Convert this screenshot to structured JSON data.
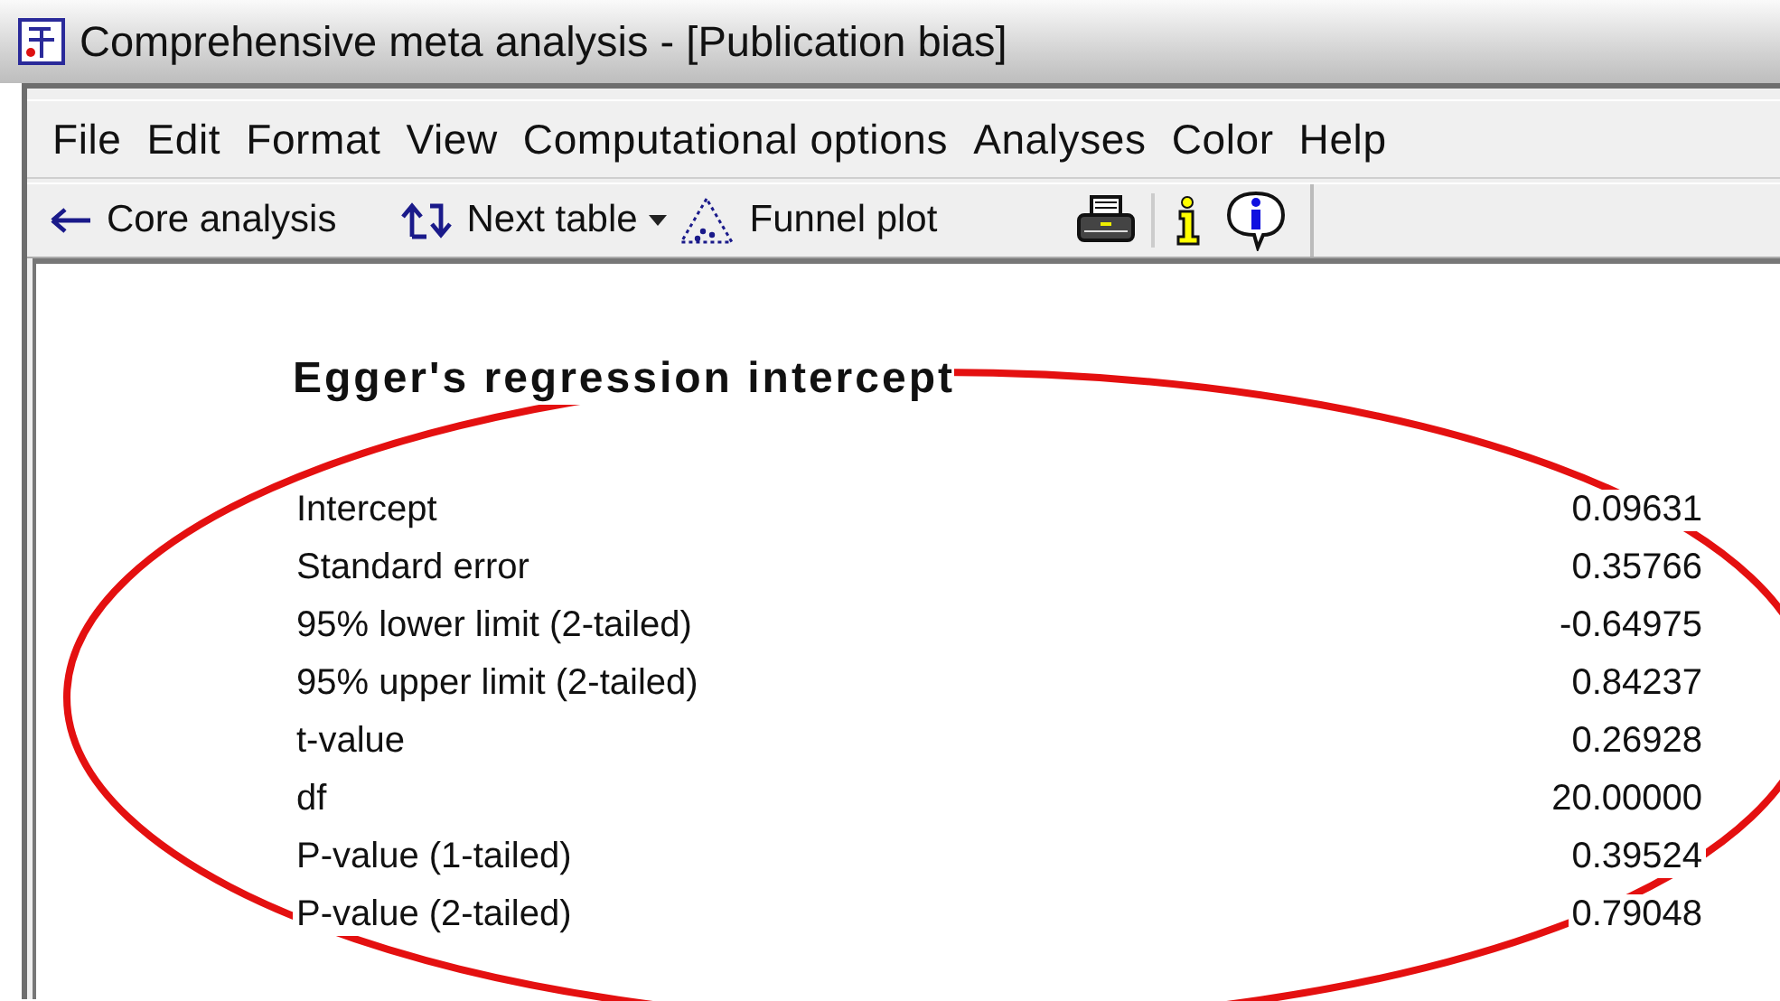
{
  "window": {
    "title": "Comprehensive meta analysis - [Publication bias]"
  },
  "menu": [
    "File",
    "Edit",
    "Format",
    "View",
    "Computational options",
    "Analyses",
    "Color",
    "Help"
  ],
  "toolbar": [
    {
      "kind": "back",
      "label": "Core analysis"
    },
    {
      "kind": "next",
      "label": "Next table"
    },
    {
      "kind": "funnel",
      "label": "Funnel plot"
    }
  ],
  "report": {
    "heading": "Egger's regression intercept",
    "rows": [
      {
        "label": "Intercept",
        "value": "0.09631"
      },
      {
        "label": "Standard error",
        "value": "0.35766"
      },
      {
        "label": "95% lower limit (2-tailed)",
        "value": "-0.64975"
      },
      {
        "label": "95% upper limit (2-tailed)",
        "value": "0.84237"
      },
      {
        "label": "t-value",
        "value": "0.26928"
      },
      {
        "label": "df",
        "value": "20.00000"
      },
      {
        "label": "P-value (1-tailed)",
        "value": "0.39524"
      },
      {
        "label": "P-value (2-tailed)",
        "value": "0.79048"
      }
    ]
  }
}
